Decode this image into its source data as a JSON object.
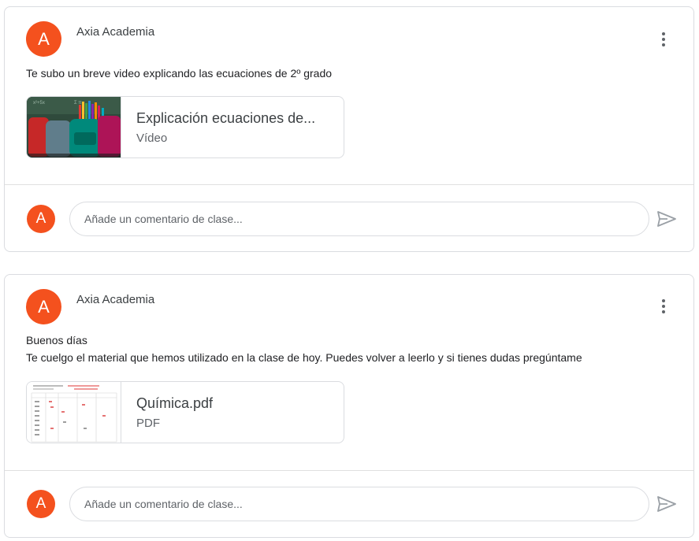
{
  "posts": [
    {
      "avatar_letter": "A",
      "author": "Axia Academia",
      "text_lines": [
        "Te subo un breve video explicando las ecuaciones de 2º grado"
      ],
      "attachment": {
        "title": "Explicación ecuaciones de...",
        "type": "Vídeo",
        "icon": "video-thumbnail"
      },
      "comment": {
        "avatar_letter": "A",
        "placeholder": "Añade un comentario de clase..."
      }
    },
    {
      "avatar_letter": "A",
      "author": "Axia Academia",
      "text_lines": [
        "Buenos días",
        "Te cuelgo el material que hemos utilizado en la clase de hoy. Puedes volver a leerlo y si tienes dudas pregúntame"
      ],
      "attachment": {
        "title": "Química.pdf",
        "type": "PDF",
        "icon": "pdf-thumbnail"
      },
      "comment": {
        "avatar_letter": "A",
        "placeholder": "Añade un comentario de clase..."
      }
    }
  ],
  "colors": {
    "avatar": "#f4511e",
    "border": "#dadce0",
    "text": "#3c4043"
  }
}
